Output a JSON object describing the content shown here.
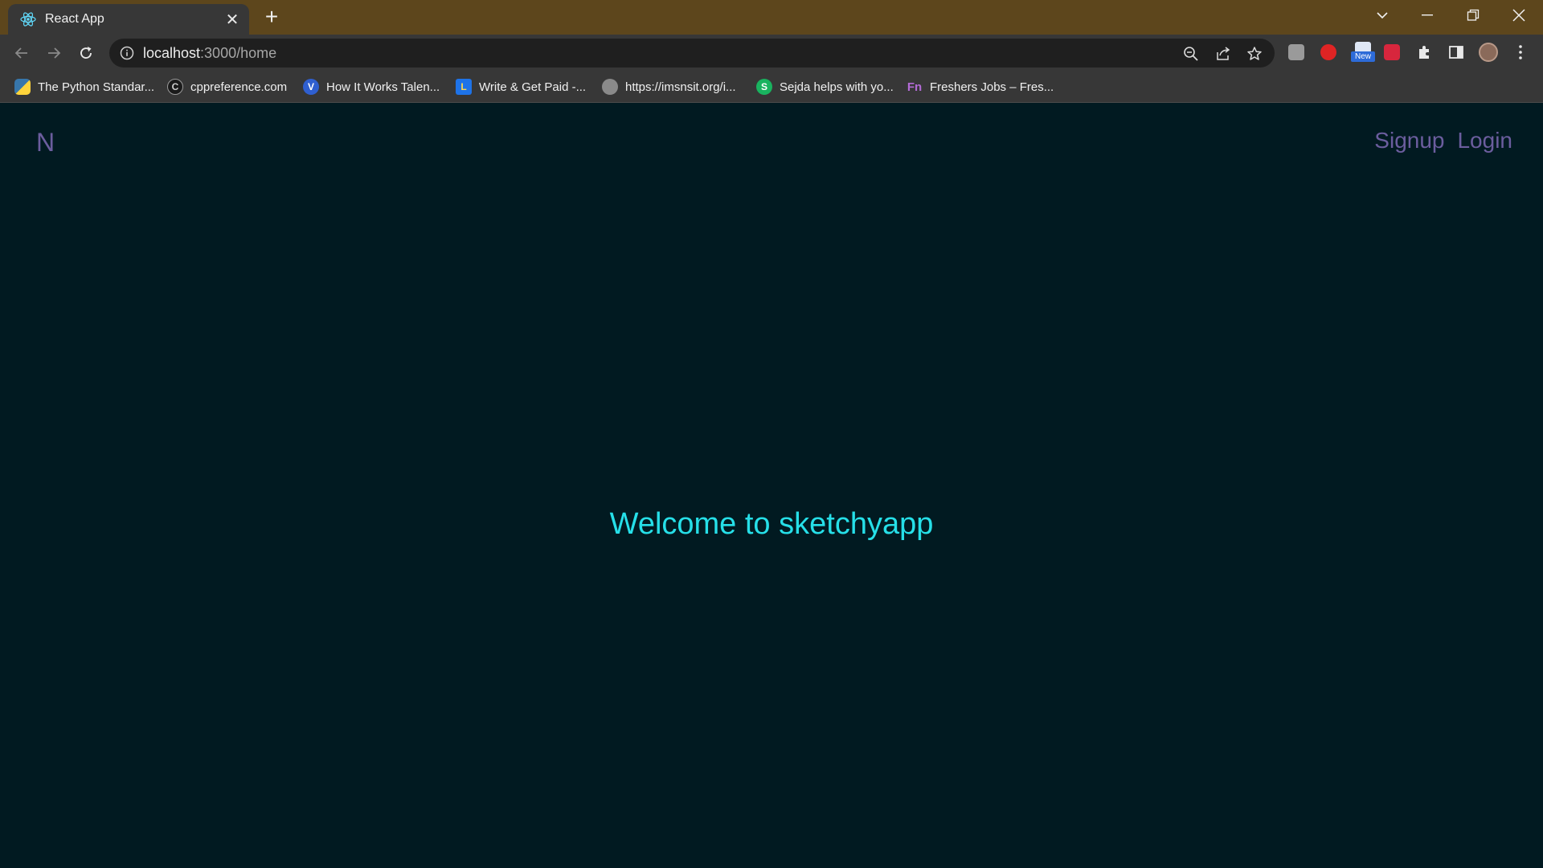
{
  "browser": {
    "tab_title": "React App",
    "url_host": "localhost",
    "url_rest": ":3000/home",
    "bookmarks": [
      {
        "label": "The Python Standar...",
        "icon": "python-icon"
      },
      {
        "label": "cppreference.com",
        "icon": "cppreference-icon"
      },
      {
        "label": "How It Works Talen...",
        "icon": "v-icon"
      },
      {
        "label": "Write & Get Paid -...",
        "icon": "document-icon"
      },
      {
        "label": "https://imsnsit.org/i...",
        "icon": "globe-icon"
      },
      {
        "label": "Sejda helps with yo...",
        "icon": "sejda-icon"
      },
      {
        "label": "Freshers Jobs – Fres...",
        "icon": "fn-icon"
      }
    ],
    "extension_badge": "New",
    "colors": {
      "frame": "#5d461c",
      "toolbar": "#373737"
    }
  },
  "app": {
    "logo": "N",
    "nav": {
      "signup": "Signup",
      "login": "Login"
    },
    "welcome": "Welcome to sketchyapp",
    "colors": {
      "background": "#011a21",
      "link": "#6b5d9e",
      "accent": "#26dfe8"
    }
  }
}
